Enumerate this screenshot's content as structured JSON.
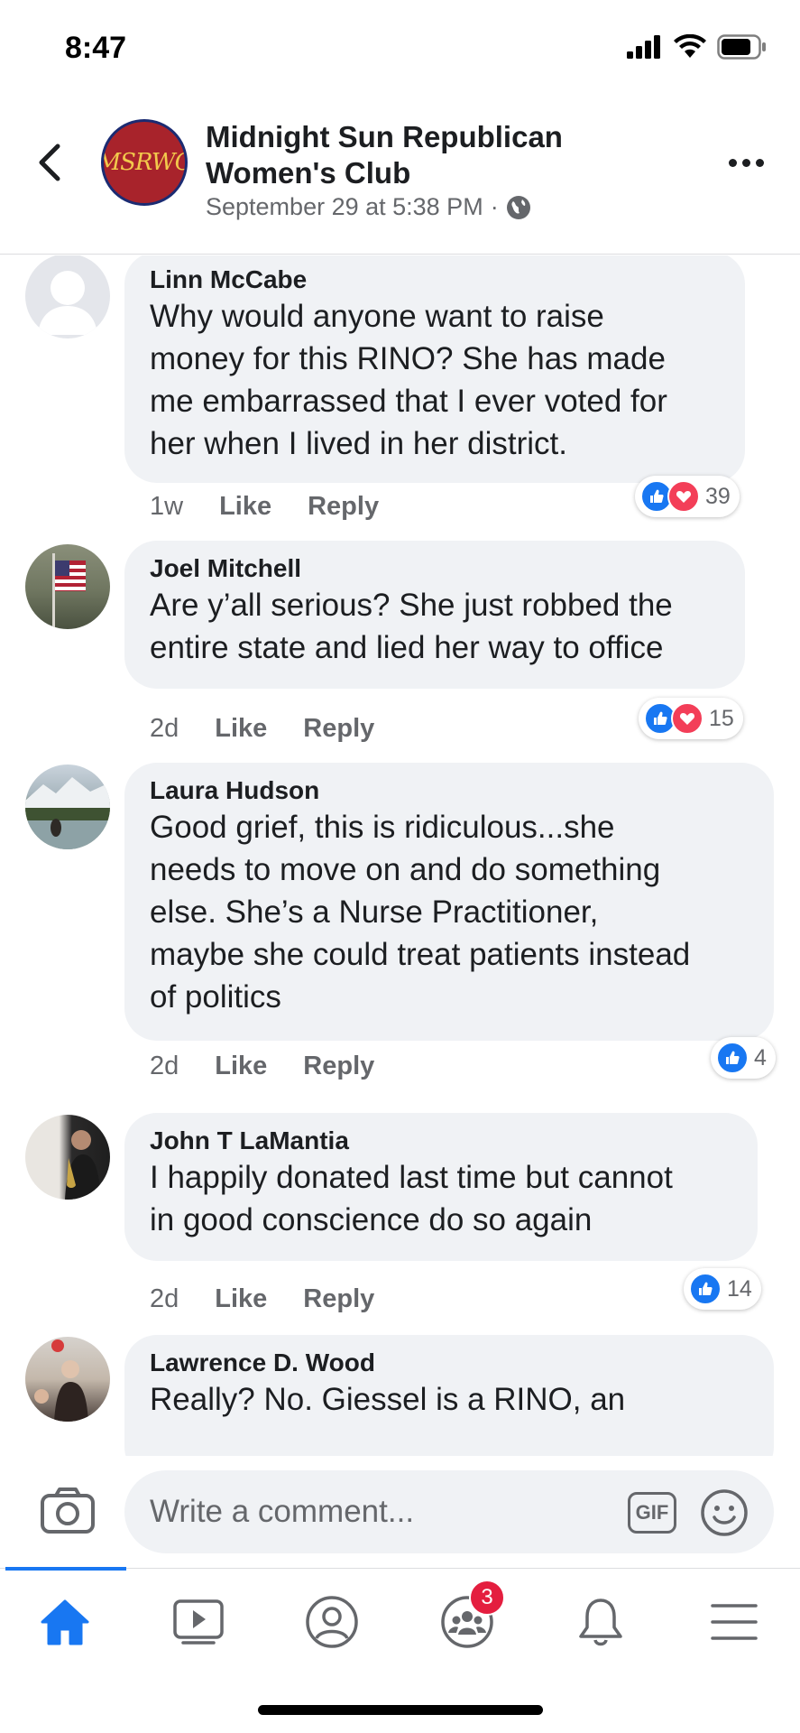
{
  "status_bar": {
    "time": "8:47"
  },
  "header": {
    "page_name": "Midnight Sun Republican Women's Club",
    "avatar_text": "MSRWC",
    "post_time": "September 29 at 5:38 PM",
    "separator": "·"
  },
  "comments": [
    {
      "author": "Linn McCabe",
      "text": "Why would anyone want to raise\nmoney for this RINO? She has made\nme embarrassed that I ever voted for\nher when I lived in her district.",
      "age": "1w",
      "like_label": "Like",
      "reply_label": "Reply",
      "reactions": [
        "like",
        "love"
      ],
      "reaction_count": "39"
    },
    {
      "author": "Joel Mitchell",
      "text": "Are y’all serious? She just robbed the\nentire state and lied her way to office",
      "age": "2d",
      "like_label": "Like",
      "reply_label": "Reply",
      "reactions": [
        "like",
        "love"
      ],
      "reaction_count": "15"
    },
    {
      "author": "Laura Hudson",
      "text": "Good grief, this is ridiculous...she\nneeds to move on and do something\nelse.  She’s a Nurse Practitioner,\nmaybe she could treat patients instead\nof politics",
      "age": "2d",
      "like_label": "Like",
      "reply_label": "Reply",
      "reactions": [
        "like"
      ],
      "reaction_count": "4"
    },
    {
      "author": "John T LaMantia",
      "text": "I happily donated last time but cannot\nin good conscience do so again",
      "age": "2d",
      "like_label": "Like",
      "reply_label": "Reply",
      "reactions": [
        "like"
      ],
      "reaction_count": "14"
    },
    {
      "author": "Lawrence D. Wood",
      "text": "Really?  No.  Giessel is a RINO, an"
    }
  ],
  "composer": {
    "placeholder": "Write a comment...",
    "gif_label": "GIF"
  },
  "tabbar": {
    "tabs": [
      "home-icon",
      "video-icon",
      "profile-icon",
      "groups-icon",
      "notifications-icon",
      "menu-icon"
    ],
    "groups_badge": "3"
  },
  "colors": {
    "accent": "#1877f2",
    "love": "#f33e58",
    "bubble": "#f0f2f5",
    "muted_text": "#65676b",
    "badge": "#e41e3f"
  }
}
